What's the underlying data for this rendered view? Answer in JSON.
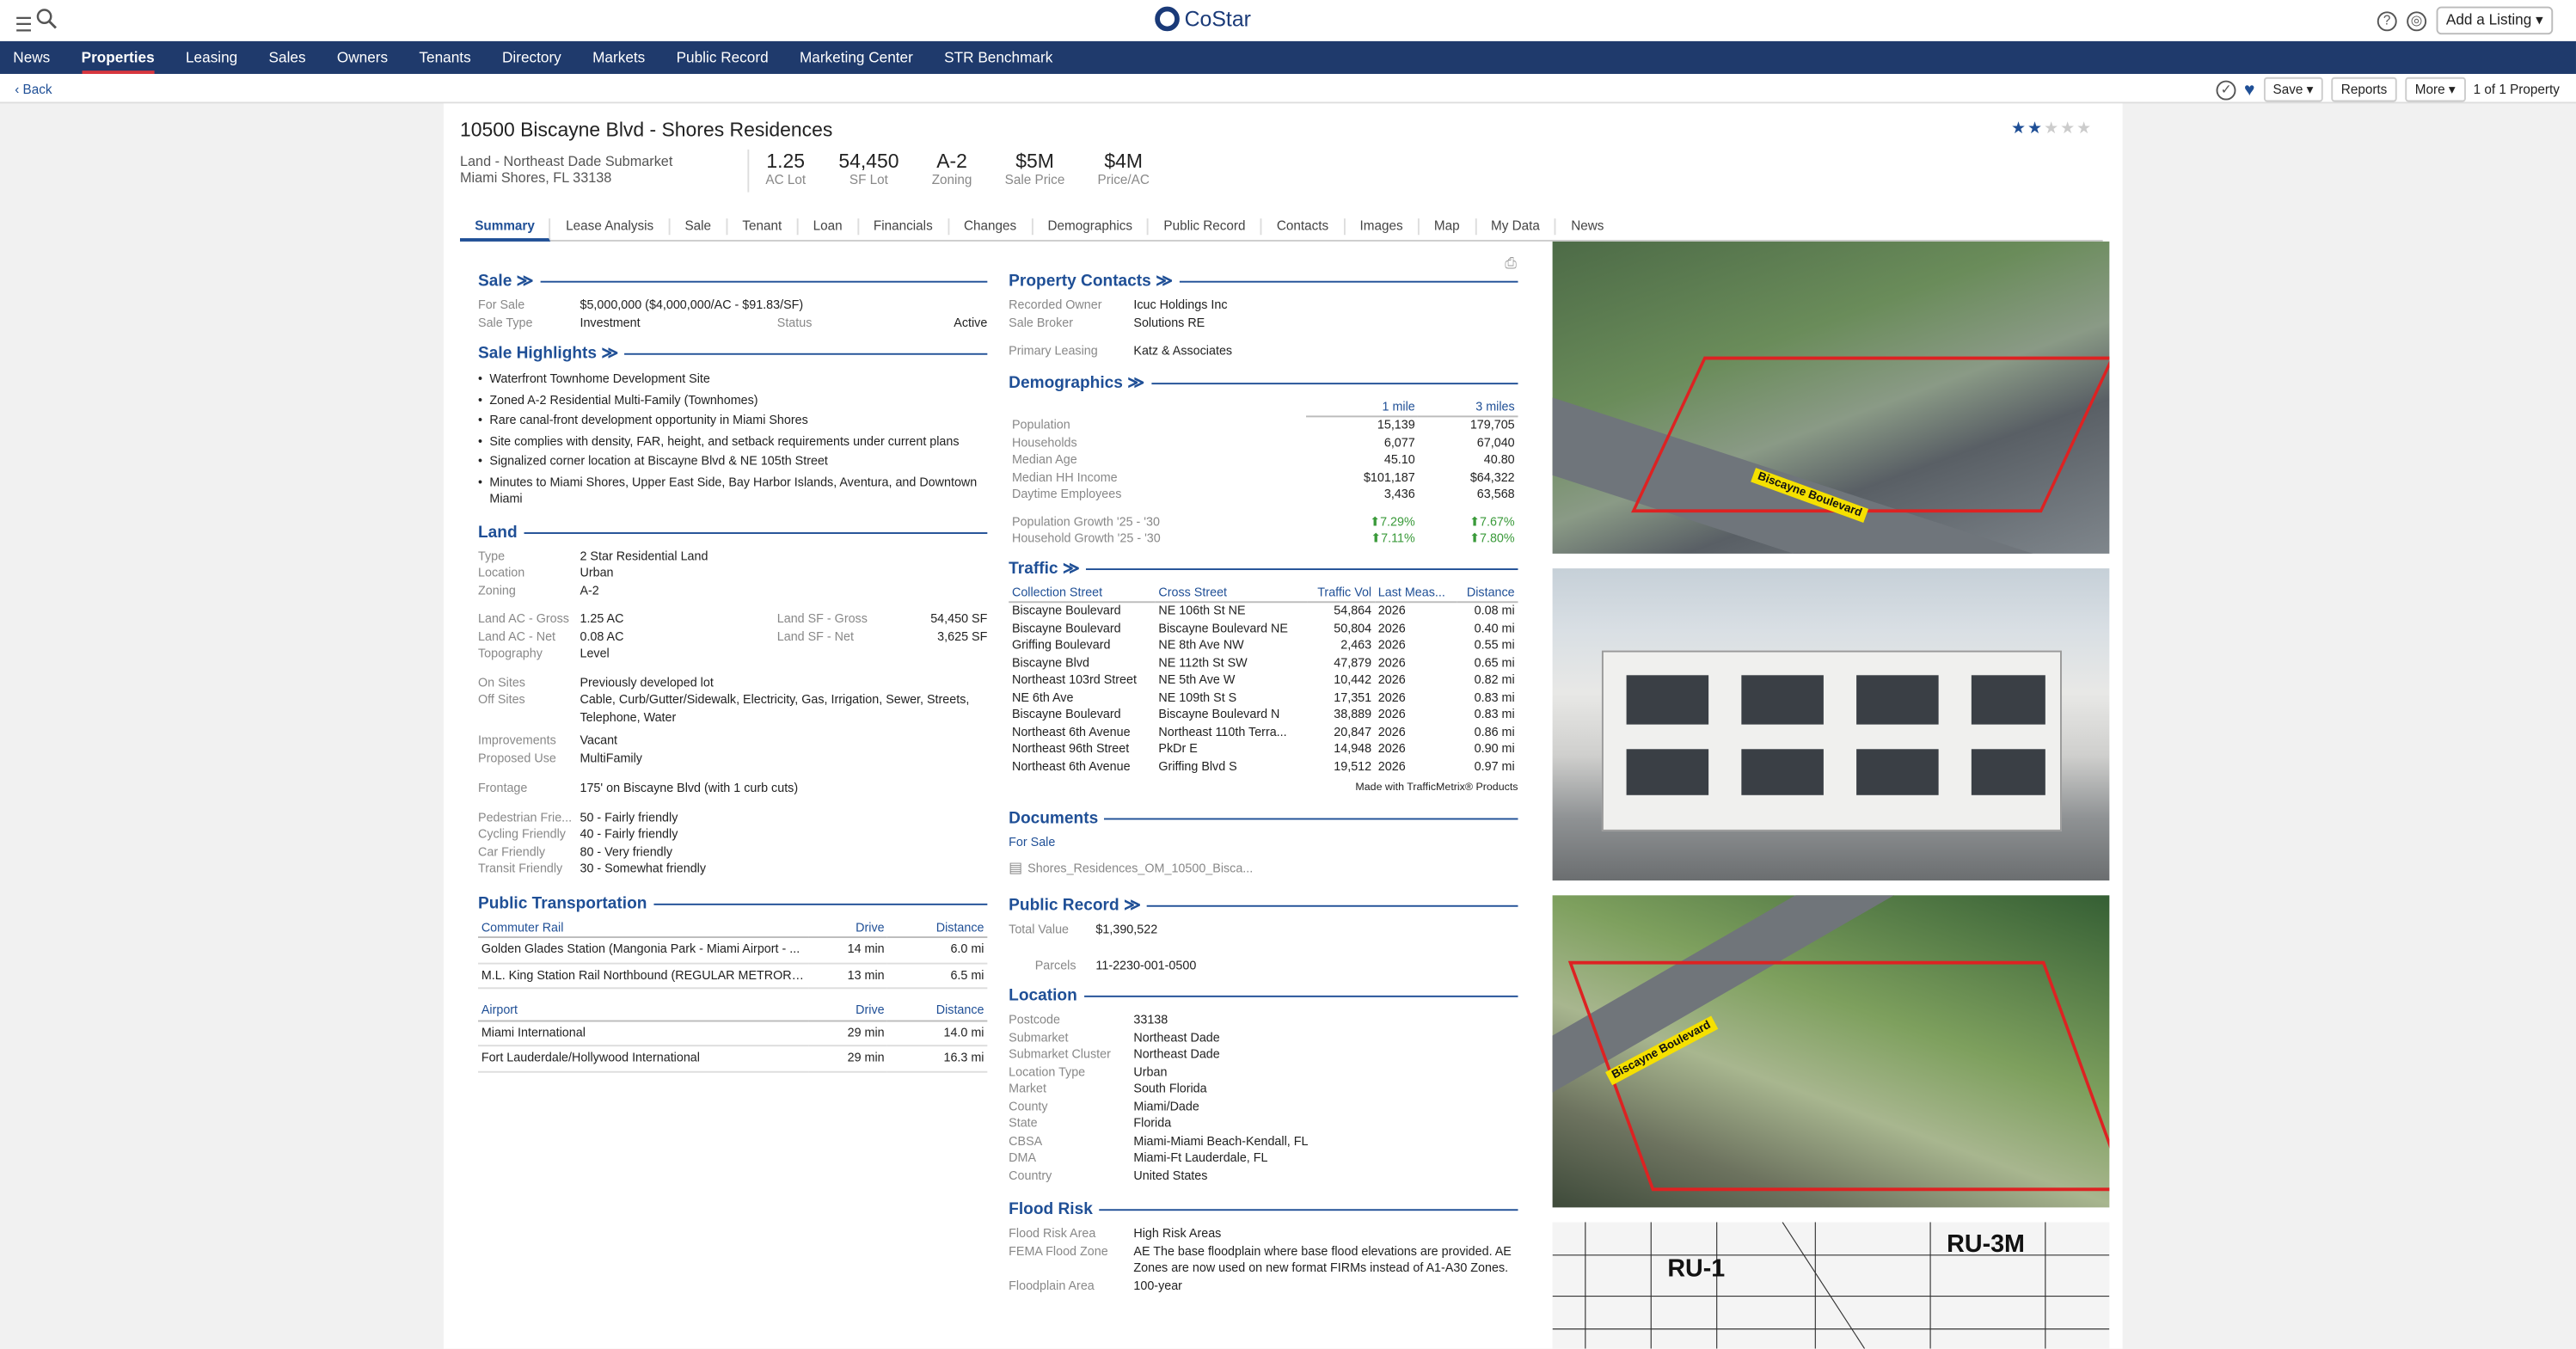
{
  "app": {
    "logo": "CoStar",
    "add_listing": "Add a Listing"
  },
  "nav": [
    "News",
    "Properties",
    "Leasing",
    "Sales",
    "Owners",
    "Tenants",
    "Directory",
    "Markets",
    "Public Record",
    "Marketing Center",
    "STR Benchmark"
  ],
  "subbar": {
    "back": "Back",
    "save": "Save",
    "reports": "Reports",
    "more": "More",
    "count": "1 of 1 Property"
  },
  "property": {
    "title": "10500 Biscayne Blvd - Shores Residences",
    "line1": "Land - Northeast Dade Submarket",
    "line2": "Miami Shores, FL 33138",
    "rating": 2,
    "metrics": [
      {
        "v": "1.25",
        "l": "AC Lot"
      },
      {
        "v": "54,450",
        "l": "SF Lot"
      },
      {
        "v": "A-2",
        "l": "Zoning"
      },
      {
        "v": "$5M",
        "l": "Sale Price"
      },
      {
        "v": "$4M",
        "l": "Price/AC"
      }
    ]
  },
  "tabs": [
    "Summary",
    "Lease Analysis",
    "Sale",
    "Tenant",
    "Loan",
    "Financials",
    "Changes",
    "Demographics",
    "Public Record",
    "Contacts",
    "Images",
    "Map",
    "My Data",
    "News"
  ],
  "sale": {
    "title": "Sale ≫",
    "for_sale_k": "For Sale",
    "for_sale_v": "$5,000,000 ($4,000,000/AC - $91.83/SF)",
    "type_k": "Sale Type",
    "type_v": "Investment",
    "status_k": "Status",
    "status_v": "Active"
  },
  "highlights": {
    "title": "Sale Highlights ≫",
    "items": [
      "Waterfront Townhome Development Site",
      "Zoned A-2 Residential Multi-Family (Townhomes)",
      "Rare canal-front development opportunity in Miami Shores",
      "Site complies with density, FAR, height, and setback requirements under current plans",
      "Signalized corner location at Biscayne Blvd & NE 105th Street",
      "Minutes to Miami Shores, Upper East Side, Bay Harbor Islands, Aventura, and Downtown Miami"
    ]
  },
  "land": {
    "title": "Land",
    "type": "2 Star Residential Land",
    "location": "Urban",
    "zoning": "A-2",
    "ac_gross": "1.25 AC",
    "ac_net": "0.08 AC",
    "sf_gross": "54,450 SF",
    "sf_net": "3,625 SF",
    "topography": "Level",
    "on_sites": "Previously developed lot",
    "off_sites": "Cable, Curb/Gutter/Sidewalk, Electricity, Gas, Irrigation, Sewer, Streets, Telephone, Water",
    "improvements": "Vacant",
    "proposed_use": "MultiFamily",
    "frontage": "175' on Biscayne Blvd (with 1 curb cuts)",
    "friendly": [
      {
        "k": "Pedestrian Frie...",
        "v": "50  -  Fairly friendly"
      },
      {
        "k": "Cycling Friendly",
        "v": "40  -  Fairly friendly"
      },
      {
        "k": "Car Friendly",
        "v": "80  -  Very friendly"
      },
      {
        "k": "Transit Friendly",
        "v": "30  -  Somewhat friendly"
      }
    ]
  },
  "transport": {
    "title": "Public Transportation",
    "rail_h": "Commuter Rail",
    "air_h": "Airport",
    "drive": "Drive",
    "distance": "Distance",
    "rail": [
      [
        "Golden Glades Station (Mangonia Park - Miami Airport - ...",
        "14 min",
        "6.0 mi"
      ],
      [
        "M.L. King Station Rail Northbound (REGULAR METRORAI...",
        "13 min",
        "6.5 mi"
      ]
    ],
    "air": [
      [
        "Miami International",
        "29 min",
        "14.0 mi"
      ],
      [
        "Fort Lauderdale/Hollywood International",
        "29 min",
        "16.3 mi"
      ]
    ]
  },
  "contacts": {
    "title": "Property Contacts ≫",
    "owner_k": "Recorded Owner",
    "owner_v": "Icuc Holdings Inc",
    "broker_k": "Sale Broker",
    "broker_v": "Solutions RE",
    "leasing_k": "Primary Leasing",
    "leasing_v": "Katz & Associates"
  },
  "demo": {
    "title": "Demographics ≫",
    "c1": "1 mile",
    "c2": "3 miles",
    "rows": [
      [
        "Population",
        "15,139",
        "179,705"
      ],
      [
        "Households",
        "6,077",
        "67,040"
      ],
      [
        "Median Age",
        "45.10",
        "40.80"
      ],
      [
        "Median HH Income",
        "$101,187",
        "$64,322"
      ],
      [
        "Daytime Employees",
        "3,436",
        "63,568"
      ]
    ],
    "growth": [
      [
        "Population Growth '25 - '30",
        "⬆7.29%",
        "⬆7.67%"
      ],
      [
        "Household Growth '25 - '30",
        "⬆7.11%",
        "⬆7.80%"
      ]
    ]
  },
  "traffic": {
    "title": "Traffic ≫",
    "headers": [
      "Collection Street",
      "Cross Street",
      "Traffic Vol",
      "Last Meas...",
      "Distance"
    ],
    "rows": [
      [
        "Biscayne Boulevard",
        "NE 106th St NE",
        "54,864",
        "2026",
        "0.08 mi"
      ],
      [
        "Biscayne Boulevard",
        "Biscayne Boulevard NE",
        "50,804",
        "2026",
        "0.40 mi"
      ],
      [
        "Griffing Boulevard",
        "NE 8th Ave NW",
        "2,463",
        "2026",
        "0.55 mi"
      ],
      [
        "Biscayne Blvd",
        "NE 112th St SW",
        "47,879",
        "2026",
        "0.65 mi"
      ],
      [
        "Northeast 103rd Street",
        "NE 5th Ave W",
        "10,442",
        "2026",
        "0.82 mi"
      ],
      [
        "NE 6th Ave",
        "NE 109th St S",
        "17,351",
        "2026",
        "0.83 mi"
      ],
      [
        "Biscayne Boulevard",
        "Biscayne Boulevard N",
        "38,889",
        "2026",
        "0.83 mi"
      ],
      [
        "Northeast 6th Avenue",
        "Northeast 110th Terra...",
        "20,847",
        "2026",
        "0.86 mi"
      ],
      [
        "Northeast 96th Street",
        "PkDr E",
        "14,948",
        "2026",
        "0.90 mi"
      ],
      [
        "Northeast 6th Avenue",
        "Griffing Blvd S",
        "19,512",
        "2026",
        "0.97 mi"
      ]
    ],
    "note": "Made with TrafficMetrix® Products"
  },
  "docs": {
    "title": "Documents",
    "sub": "For Sale",
    "file": "Shores_Residences_OM_10500_Bisca..."
  },
  "public_record": {
    "title": "Public Record ≫",
    "tv_k": "Total Value",
    "tv_v": "$1,390,522",
    "parcels_k": "Parcels",
    "parcels_v": "11-2230-001-0500"
  },
  "location": {
    "title": "Location",
    "rows": [
      [
        "Postcode",
        "33138"
      ],
      [
        "Submarket",
        "Northeast Dade"
      ],
      [
        "Submarket Cluster",
        "Northeast Dade"
      ],
      [
        "Location Type",
        "Urban"
      ],
      [
        "Market",
        "South Florida"
      ],
      [
        "County",
        "Miami/Dade"
      ],
      [
        "State",
        "Florida"
      ],
      [
        "CBSA",
        "Miami-Miami Beach-Kendall, FL"
      ],
      [
        "DMA",
        "Miami-Ft Lauderdale, FL"
      ],
      [
        "Country",
        "United States"
      ]
    ]
  },
  "flood": {
    "title": "Flood Risk",
    "rows": [
      [
        "Flood Risk Area",
        "High Risk Areas"
      ],
      [
        "FEMA Flood Zone",
        "AE The base floodplain where base flood elevations are provided. AE Zones are now used on new format FIRMs instead of A1-A30 Zones."
      ],
      [
        "Floodplain Area",
        "100-year"
      ]
    ]
  },
  "photos": {
    "road1": "Biscayne Boulevard",
    "road2": "Biscayne Boulevard",
    "map_l": "RU-1",
    "map_r": "RU-3M"
  }
}
